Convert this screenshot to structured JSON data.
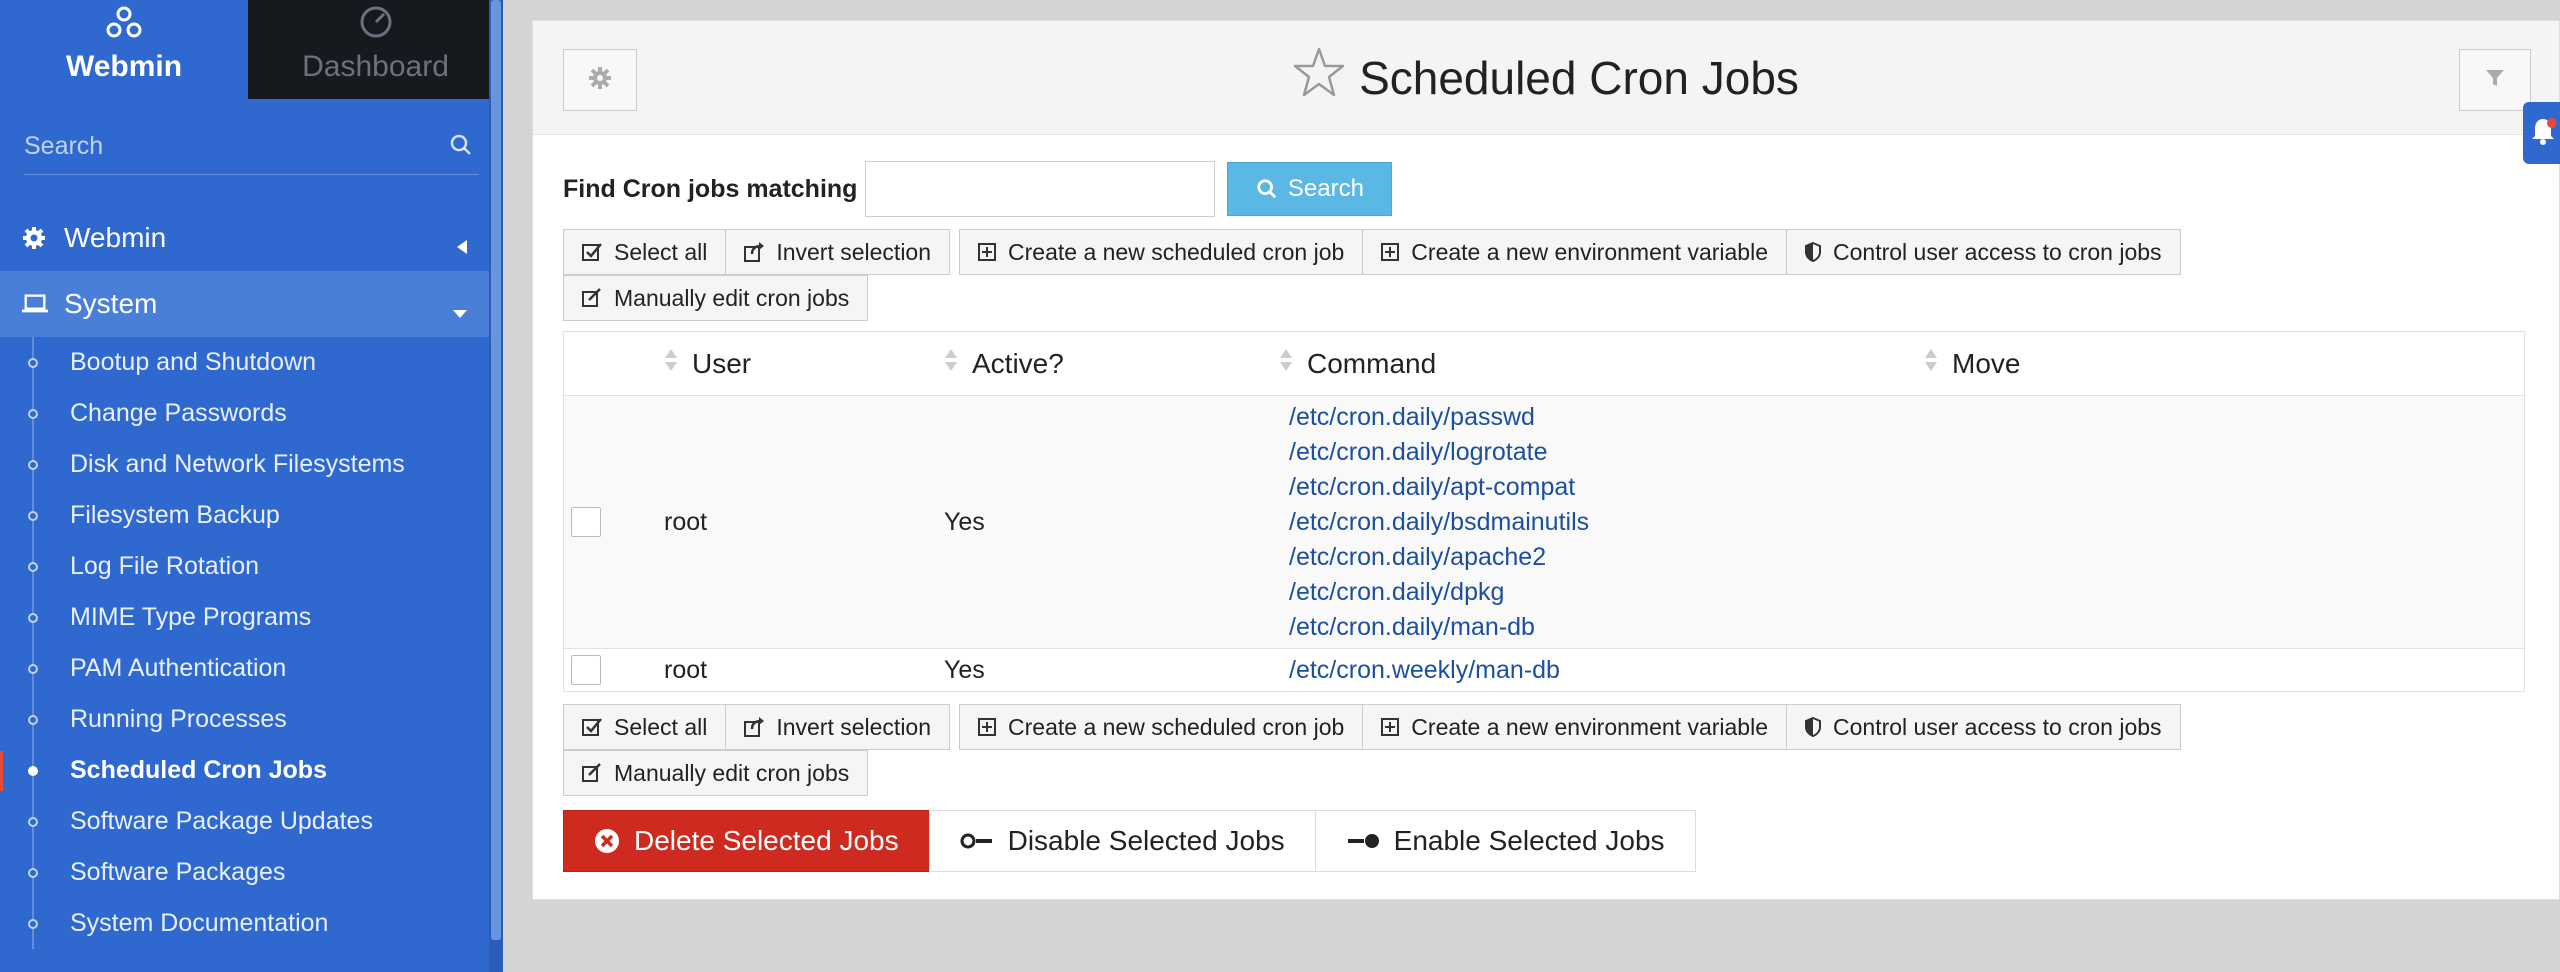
{
  "sidebar": {
    "tabs": {
      "webmin": "Webmin",
      "dashboard": "Dashboard"
    },
    "search_placeholder": "Search",
    "sections": {
      "webmin": "Webmin",
      "system": "System"
    },
    "items": [
      {
        "label": "Bootup and Shutdown"
      },
      {
        "label": "Change Passwords"
      },
      {
        "label": "Disk and Network Filesystems"
      },
      {
        "label": "Filesystem Backup"
      },
      {
        "label": "Log File Rotation"
      },
      {
        "label": "MIME Type Programs"
      },
      {
        "label": "PAM Authentication"
      },
      {
        "label": "Running Processes"
      },
      {
        "label": "Scheduled Cron Jobs"
      },
      {
        "label": "Software Package Updates"
      },
      {
        "label": "Software Packages"
      },
      {
        "label": "System Documentation"
      }
    ]
  },
  "page": {
    "title": "Scheduled Cron Jobs",
    "find_label": "Find Cron jobs matching",
    "search_button": "Search"
  },
  "toolbar": {
    "select_all": "Select all",
    "invert": "Invert selection",
    "create_job": "Create a new scheduled cron job",
    "create_env": "Create a new environment variable",
    "control_access": "Control user access to cron jobs",
    "manual_edit": "Manually edit cron jobs"
  },
  "table": {
    "headers": {
      "user": "User",
      "active": "Active?",
      "command": "Command",
      "move": "Move"
    },
    "rows": [
      {
        "user": "root",
        "active": "Yes",
        "commands": [
          "/etc/cron.daily/passwd",
          "/etc/cron.daily/logrotate",
          "/etc/cron.daily/apt-compat",
          "/etc/cron.daily/bsdmainutils",
          "/etc/cron.daily/apache2",
          "/etc/cron.daily/dpkg",
          "/etc/cron.daily/man-db"
        ]
      },
      {
        "user": "root",
        "active": "Yes",
        "commands": [
          "/etc/cron.weekly/man-db"
        ]
      }
    ]
  },
  "actions": {
    "delete": "Delete Selected Jobs",
    "disable": "Disable Selected Jobs",
    "enable": "Enable Selected Jobs"
  },
  "colors": {
    "sidebar_bg": "#2f68cf",
    "danger": "#cf2a1f",
    "search_btn": "#5bb7e3",
    "link": "#1c4fa0"
  }
}
